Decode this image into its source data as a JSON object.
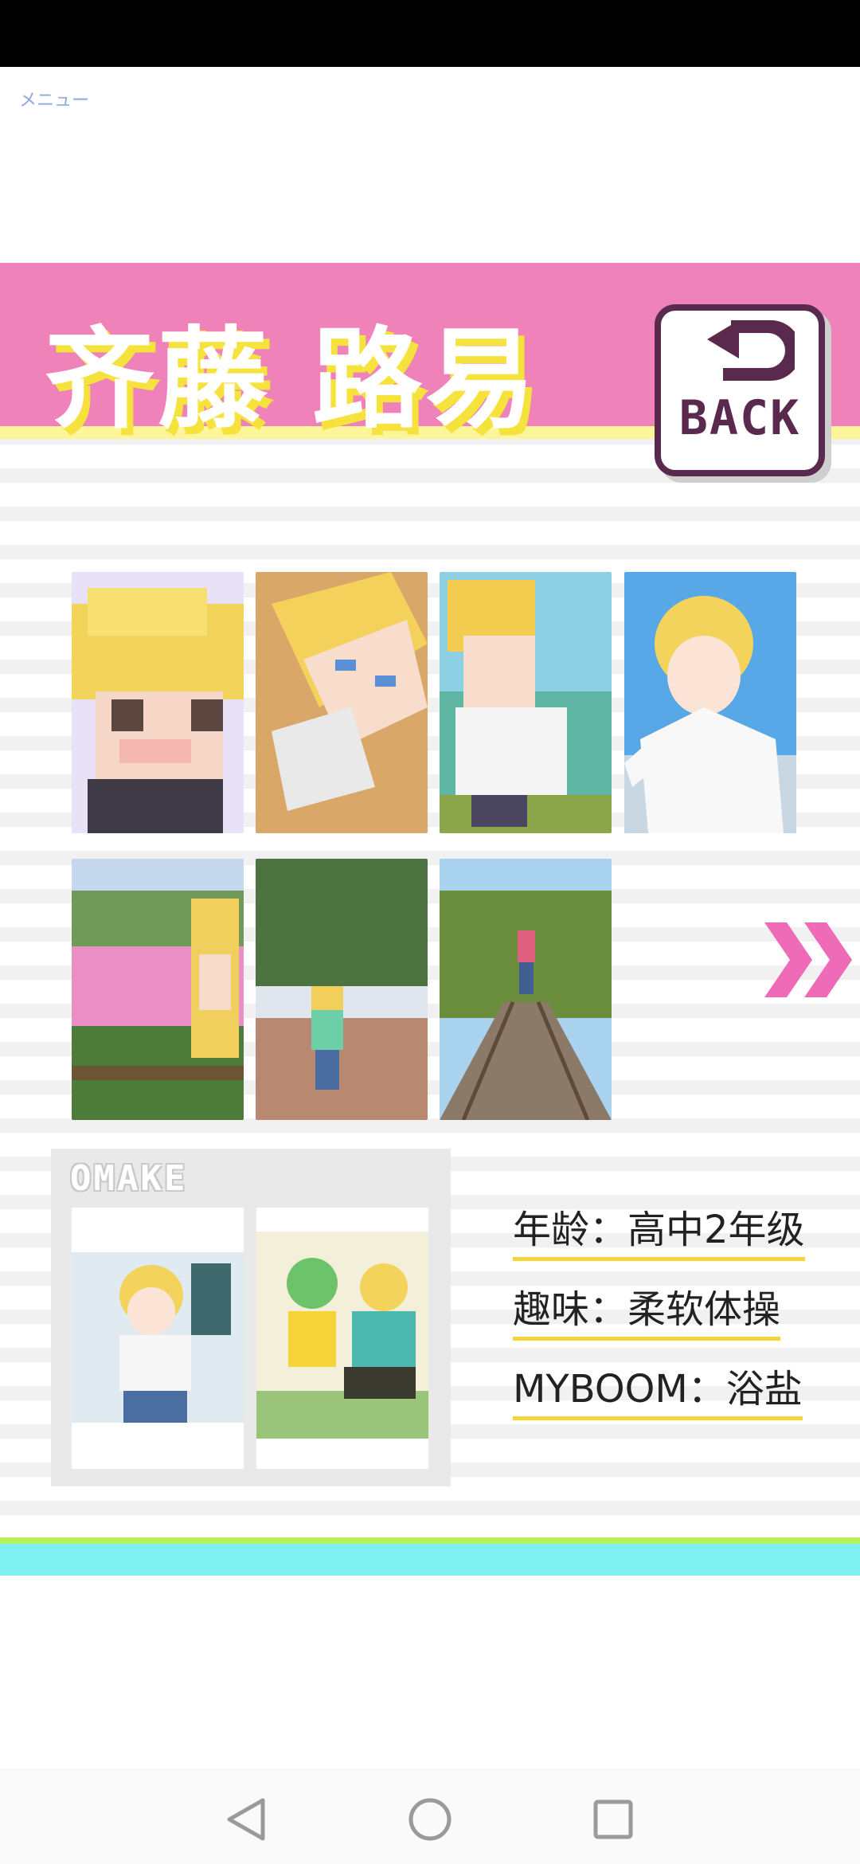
{
  "menu": {
    "label": "メニュー"
  },
  "header": {
    "name": "齐藤 路易",
    "back_label": "BACK"
  },
  "gallery": {
    "items": [
      {
        "name": "gallery-item-1",
        "alt": "pixel-portrait"
      },
      {
        "name": "gallery-item-2",
        "alt": "pixel-lying"
      },
      {
        "name": "gallery-item-3",
        "alt": "pixel-lake"
      },
      {
        "name": "gallery-item-4",
        "alt": "anime-portrait"
      },
      {
        "name": "gallery-item-5",
        "alt": "flower-field"
      },
      {
        "name": "gallery-item-6",
        "alt": "park-path"
      },
      {
        "name": "gallery-item-7",
        "alt": "railway"
      }
    ],
    "next_icon": "double-chevron-right-icon"
  },
  "omake": {
    "label": "OMAKE"
  },
  "profile": {
    "age": "年龄：高中2年级",
    "hobby": "趣味：柔软体操",
    "myboom": "MYBOOM：浴盐"
  },
  "colors": {
    "header_pink": "#ef82b9",
    "title_shadow_yellow": "#f5e23c",
    "back_border": "#5a2a4e",
    "arrow_pink": "#f06bb7",
    "underline_yellow": "#f5d33a",
    "footer_cyan": "#7ef0f2",
    "footer_green": "#b8f25a"
  },
  "navigation": {
    "back_icon": "triangle-back-icon",
    "home_icon": "circle-home-icon",
    "recents_icon": "square-recents-icon"
  }
}
